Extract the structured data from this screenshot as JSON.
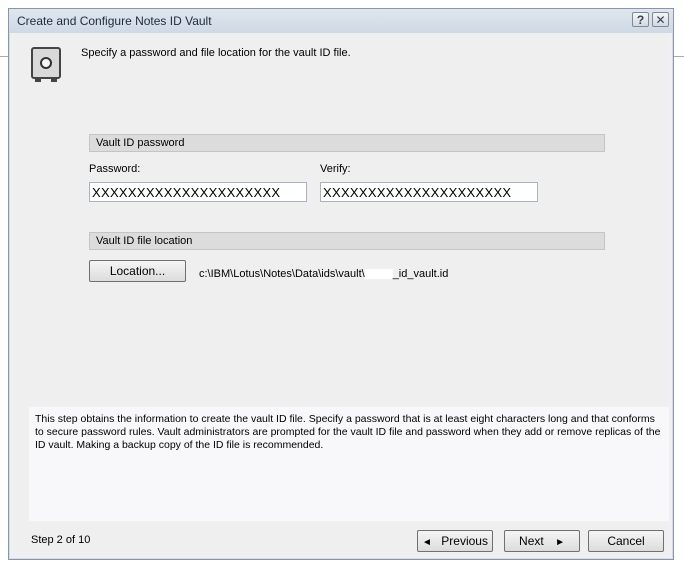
{
  "window": {
    "title": "Create and Configure Notes ID Vault",
    "help_symbol": "?",
    "close_symbol": "✕"
  },
  "header": {
    "icon": "safe-icon",
    "text": "Specify a password and file location for the vault ID file."
  },
  "password_section": {
    "title": "Vault ID password",
    "password_label": "Password:",
    "password_value": "XXXXXXXXXXXXXXXXXXXXX",
    "verify_label": "Verify:",
    "verify_value": "XXXXXXXXXXXXXXXXXXXXX"
  },
  "file_section": {
    "title": "Vault ID file location",
    "location_button": "Location...",
    "path_prefix": "c:\\IBM\\Lotus\\Notes\\Data\\ids\\vault\\",
    "path_suffix": "_id_vault.id"
  },
  "info_text": "This step obtains the information to create the vault ID file.  Specify a password that is at least eight characters long and that conforms to secure password rules.  Vault administrators are prompted for the vault ID file and password when they add or remove replicas of the ID vault.  Making a backup copy of the ID file is recommended.",
  "footer": {
    "step": "Step 2 of 10",
    "previous": "Previous",
    "next": "Next",
    "cancel": "Cancel",
    "previous_arrow": "◄",
    "next_arrow": "►"
  }
}
